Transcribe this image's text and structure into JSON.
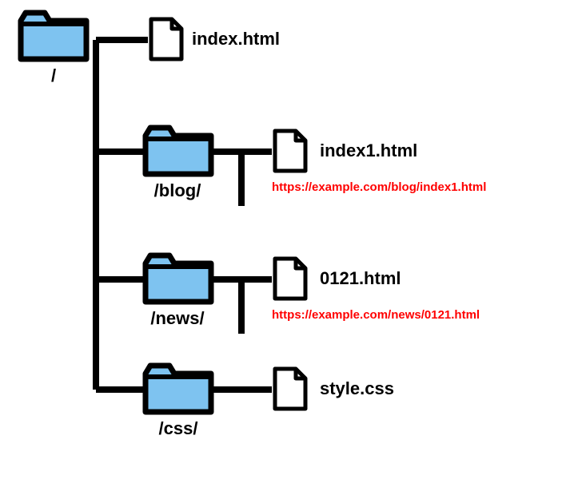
{
  "tree": {
    "root": {
      "label": "/",
      "children": [
        {
          "type": "file",
          "label": "index.html"
        },
        {
          "type": "folder",
          "label": "/blog/",
          "children": [
            {
              "type": "file",
              "label": "index1.html",
              "url": "https://example.com/blog/index1.html"
            }
          ]
        },
        {
          "type": "folder",
          "label": "/news/",
          "children": [
            {
              "type": "file",
              "label": "0121.html",
              "url": "https://example.com/news/0121.html"
            }
          ]
        },
        {
          "type": "folder",
          "label": "/css/",
          "children": [
            {
              "type": "file",
              "label": "style.css"
            }
          ]
        }
      ]
    }
  },
  "colors": {
    "folder_fill": "#7ec3f0",
    "folder_stroke": "#000000",
    "file_fill": "#ffffff",
    "file_stroke": "#000000",
    "line": "#000000",
    "url": "#ff0000"
  }
}
